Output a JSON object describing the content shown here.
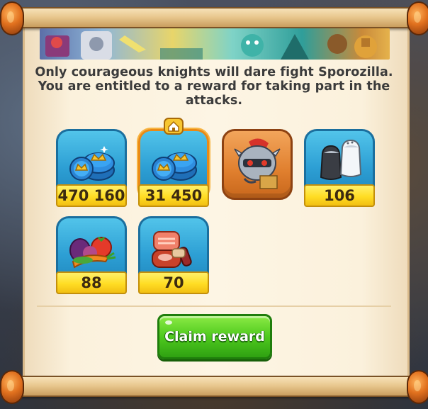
{
  "dialog": {
    "message_lines": [
      "Only courageous knights will dare fight Sporozilla.",
      "You are entitled to a reward for taking part in the",
      "attacks."
    ]
  },
  "rewards": [
    {
      "icon": "crown-coins-icon",
      "amount": "470 160",
      "tile": "blue"
    },
    {
      "icon": "crown-coins-icon",
      "amount": "31 450",
      "tile": "blue",
      "badge": "house-icon"
    },
    {
      "icon": "knight-helmet-icon",
      "amount": "",
      "tile": "orange"
    },
    {
      "icon": "salt-pepper-icon",
      "amount": "106",
      "tile": "blue"
    },
    {
      "icon": "vegetables-icon",
      "amount": "88",
      "tile": "blue"
    },
    {
      "icon": "meat-icon",
      "amount": "70",
      "tile": "blue"
    }
  ],
  "actions": {
    "claim_label": "Claim reward"
  },
  "colors": {
    "tile_blue": "#2d9fd4",
    "tile_orange": "#e07f2e",
    "label_yellow": "#ffdd24",
    "claim_green": "#4fca1e",
    "parchment": "#fdf5e4"
  }
}
